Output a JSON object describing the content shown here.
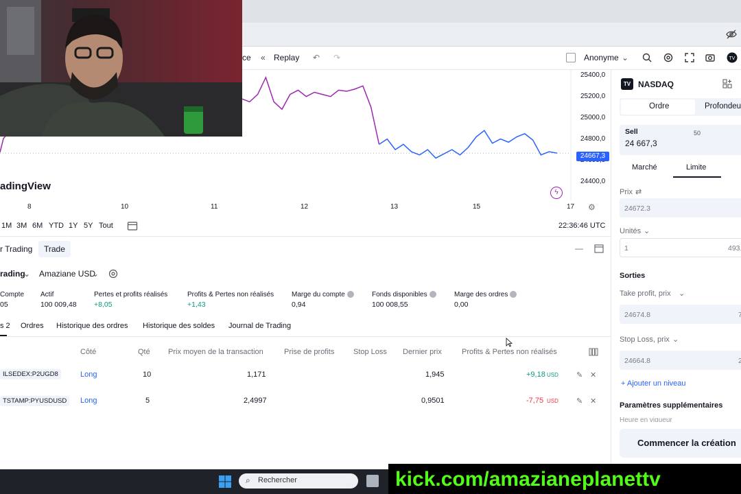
{
  "toolbar": {
    "partial_label": "ce",
    "replay": "Replay",
    "anonymous": "Anonyme"
  },
  "chart": {
    "brand": "adingView",
    "last_price_tag": "24667,3",
    "y_ticks": [
      "25400,0",
      "25200,0",
      "25000,0",
      "24800,0",
      "24600,0",
      "24400,0"
    ],
    "x_ticks": [
      "8",
      "10",
      "11",
      "12",
      "13",
      "15",
      "17"
    ],
    "ranges": [
      "1M",
      "3M",
      "6M",
      "YTD",
      "1Y",
      "5Y",
      "Tout"
    ],
    "time": "22:36:46 UTC"
  },
  "chart_data": {
    "type": "line",
    "series": [
      {
        "values": [
          25180,
          25150,
          25220,
          25380,
          25150,
          25080,
          25220,
          25260,
          25200,
          25240,
          25220,
          25200,
          25260,
          25250,
          25270,
          25300,
          25100,
          24750,
          24800,
          24700,
          24750,
          24680,
          24650,
          24700,
          24620,
          24660,
          24700,
          24650,
          24720,
          24820,
          24880,
          24760,
          24800,
          24770,
          24820,
          24850,
          24790,
          24650,
          24680,
          24667
        ]
      }
    ],
    "ylim": [
      24300,
      25450
    ],
    "y_ticks": [
      25400,
      25200,
      25000,
      24800,
      24600,
      24400
    ],
    "x_ticks": [
      "8",
      "10",
      "11",
      "12",
      "13",
      "15",
      "17"
    ],
    "color": "#9c27b0",
    "secondary_color": "#2962ff"
  },
  "panel": {
    "tabs": [
      "r Trading",
      "Trade"
    ],
    "account_name": "rading",
    "account_currency": "Amaziane USD",
    "stats": [
      {
        "label": "Compte",
        "value": "05"
      },
      {
        "label": "Actif",
        "value": "100 009,48"
      },
      {
        "label": "Pertes et profits réalisés",
        "value": "+8,05"
      },
      {
        "label": "Profits & Pertes non réalisés",
        "value": "+1,43"
      },
      {
        "label": "Marge du compte",
        "value": "0,94"
      },
      {
        "label": "Fonds disponibles",
        "value": "100 008,55"
      },
      {
        "label": "Marge des ordres",
        "value": "0,00"
      }
    ],
    "subtabs": [
      "s 2",
      "Ordres",
      "Historique des ordres",
      "Historique des soldes",
      "Journal de Trading"
    ],
    "columns": [
      "Côté",
      "Qté",
      "Prix moyen de la transaction",
      "Prise de profits",
      "Stop Loss",
      "Dernier prix",
      "Profits & Pertes non réalisés"
    ],
    "rows": [
      {
        "symbol": "ILSEDEX:P2UGD8",
        "side": "Long",
        "qty": "10",
        "avg": "1,171",
        "last": "1,945",
        "pnl": "+9,18",
        "ccy": "USD"
      },
      {
        "symbol": "TSTAMP:PYUSDUSD",
        "side": "Long",
        "qty": "5",
        "avg": "2,4997",
        "last": "0,9501",
        "pnl": "-7,75",
        "ccy": "USD"
      }
    ]
  },
  "order": {
    "symbol": "NASDAQ",
    "tabs": [
      "Ordre",
      "Profondeur"
    ],
    "sell_label": "Sell",
    "sell_price": "24 667,3",
    "spread": "50",
    "sell_cut": "2",
    "types": [
      "Marché",
      "Limite"
    ],
    "price_label": "Prix",
    "price_value": "24672.3",
    "units_label": "Unités",
    "units_value": "1",
    "units_right": "493.",
    "exits": "Sorties",
    "tp_label": "Take profit, prix",
    "tp_value": "24674.8",
    "tp_right": "7",
    "sl_label": "Stop Loss, prix",
    "sl_value": "24664.8",
    "sl_right": "2",
    "add_level": "+ Ajouter un niveau",
    "extra_params": "Paramètres supplémentaires",
    "hours": "Heure en vigueur",
    "start_button": "Commencer la création"
  },
  "taskbar": {
    "search": "Rechercher"
  },
  "overlay": {
    "kick": "kick.com/amazianeplanettv"
  }
}
